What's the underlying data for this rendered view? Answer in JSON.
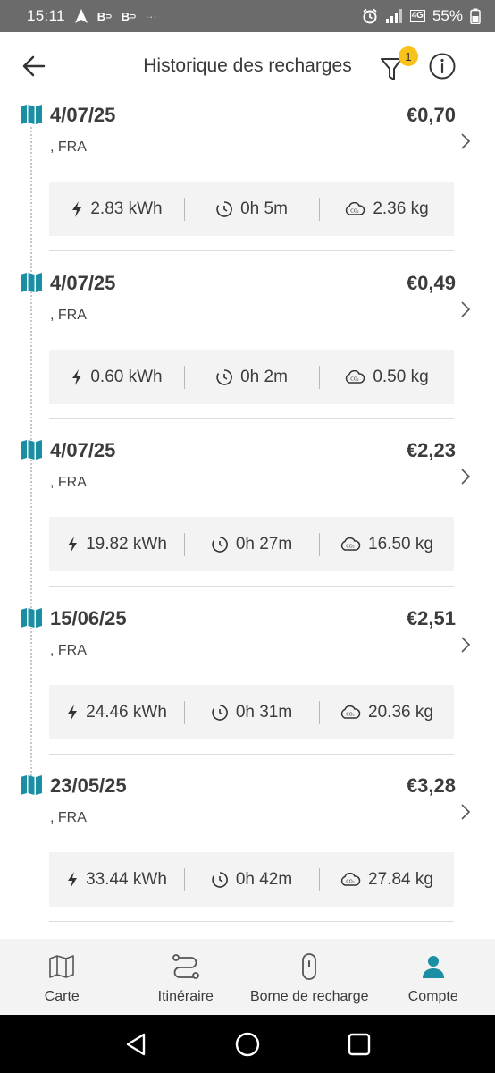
{
  "status_bar": {
    "time": "15:11",
    "battery": "55%",
    "icons": [
      "navigation-icon",
      "b-app-icon",
      "b-app-icon",
      "more-dots-icon",
      "alarm-icon",
      "signal-icon",
      "4g-icon",
      "battery-icon"
    ]
  },
  "header": {
    "title": "Historique des recharges",
    "filter_badge": "1"
  },
  "colors": {
    "accent": "#1a8fa3",
    "badge": "#f7c21b",
    "card_bg": "#f3f3f3"
  },
  "entries": [
    {
      "date": "4/07/25",
      "price": "€0,70",
      "location": ", FRA",
      "energy": "2.83 kWh",
      "duration": "0h 5m",
      "co2": "2.36 kg"
    },
    {
      "date": "4/07/25",
      "price": "€0,49",
      "location": ", FRA",
      "energy": "0.60 kWh",
      "duration": "0h 2m",
      "co2": "0.50 kg"
    },
    {
      "date": "4/07/25",
      "price": "€2,23",
      "location": ", FRA",
      "energy": "19.82 kWh",
      "duration": "0h 27m",
      "co2": "16.50 kg"
    },
    {
      "date": "15/06/25",
      "price": "€2,51",
      "location": ", FRA",
      "energy": "24.46 kWh",
      "duration": "0h 31m",
      "co2": "20.36 kg"
    },
    {
      "date": "23/05/25",
      "price": "€3,28",
      "location": ", FRA",
      "energy": "33.44 kWh",
      "duration": "0h 42m",
      "co2": "27.84 kg"
    }
  ],
  "bottom_nav": [
    {
      "label": "Carte",
      "icon": "map-icon",
      "active": false
    },
    {
      "label": "Itinéraire",
      "icon": "route-icon",
      "active": false
    },
    {
      "label": "Borne de recharge",
      "icon": "charger-icon",
      "active": false
    },
    {
      "label": "Compte",
      "icon": "person-icon",
      "active": true
    }
  ]
}
